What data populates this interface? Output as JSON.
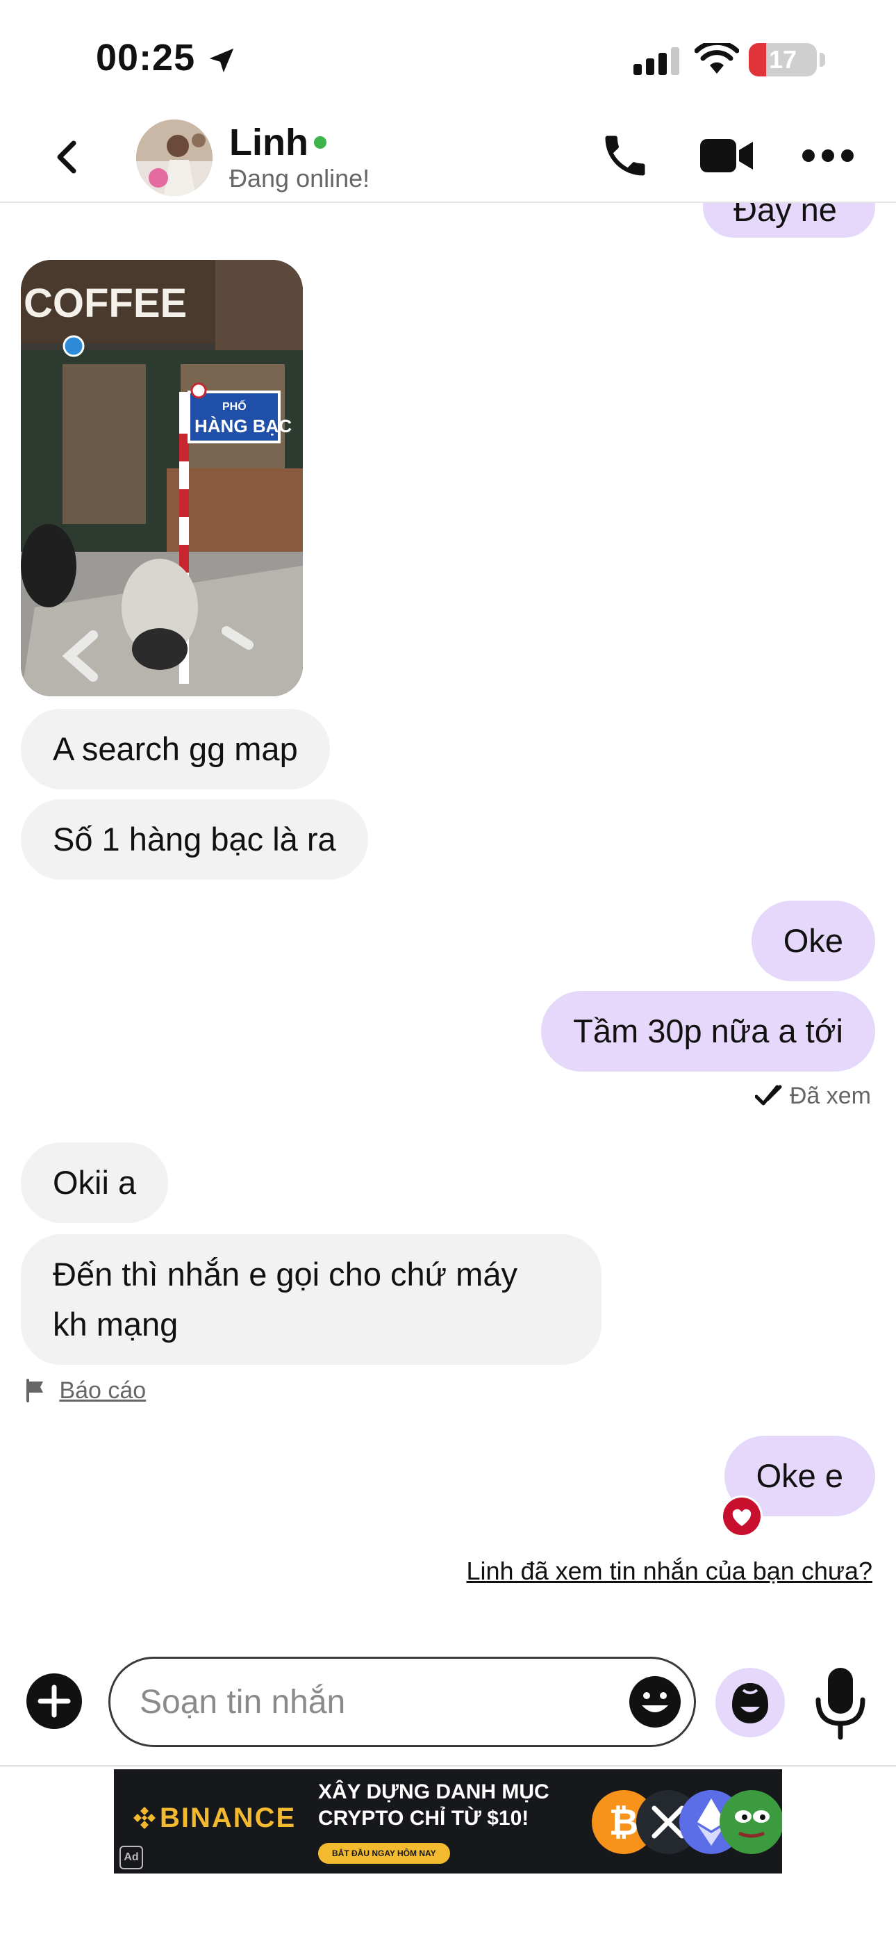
{
  "status_bar": {
    "time": "00:25",
    "battery_label": "17",
    "battery_level_percent": 17
  },
  "header": {
    "name": "Linh",
    "status": "Đang online!",
    "icons": [
      "back-arrow-icon",
      "phone-icon",
      "video-camera-icon",
      "more-icon"
    ]
  },
  "messages": {
    "partial_outgoing": "Đây nè",
    "incoming_1": "A search gg map",
    "incoming_2": "Số 1 hàng bạc là ra",
    "outgoing_1": "Oke",
    "outgoing_2": "Tầm 30p nữa a tới",
    "read_receipt": "Đã xem",
    "incoming_3": "Okii a",
    "incoming_4_line1": "Đến thì nhắn e gọi cho chứ máy",
    "incoming_4_line2": "kh mạng",
    "report": "Báo cáo",
    "outgoing_3": "Oke e",
    "seen_question": "Linh đã xem tin nhắn của bạn chưa?"
  },
  "photo": {
    "sign_text": "COFFEE",
    "street_sign_top": "PHỐ",
    "street_sign_main": "HÀNG BẠC"
  },
  "composer": {
    "placeholder": "Soạn tin nhắn"
  },
  "ad": {
    "brand": "BINANCE",
    "headline": "XÂY DỰNG DANH MỤC\nCRYPTO CHỈ TỪ $10!",
    "cta": "BẮT ĐẦU NGAY HÔM NAY",
    "badge": "Ad"
  },
  "colors": {
    "outgoing_bubble": "#e6d8fb",
    "incoming_bubble": "#f2f2f2",
    "online": "#3db54a",
    "battery_low": "#e0343a",
    "binance_yellow": "#f3ba2f"
  }
}
